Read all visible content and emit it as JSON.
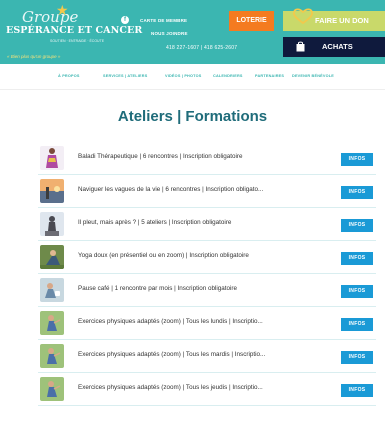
{
  "header": {
    "logo": {
      "script": "Groupe",
      "main": "ESPÉRANCE ET CANCER",
      "sub": "SOUTIEN · ENTRAIDE · ÉCOUTE",
      "tagline": "« Bien plus qu'un groupe »"
    },
    "links": {
      "carte": "CARTE DE MEMBRE",
      "joindre": "NOUS JOINDRE"
    },
    "phones": "418 227-1607 | 418 625-2607",
    "buttons": {
      "loterie": "LOTERIE",
      "don": "FAIRE UN DON",
      "achats": "ACHATS"
    }
  },
  "nav": {
    "items": [
      "À PROPOS",
      "SERVICES | ATELIERS",
      "VIDÉOS | PHOTOS",
      "CALENDRIERS",
      "PARTENAIRES",
      "DEVENIR BÉNÉVOLE"
    ]
  },
  "main": {
    "title": "Ateliers | Formations",
    "infos_label": "INFOS",
    "items": [
      {
        "label": "Baladi Thérapeutique | 6 rencontres | Inscription obligatoire",
        "thumb": "dancer"
      },
      {
        "label": "Naviguer les vagues de la vie | 6 rencontres | Inscription obligato...",
        "thumb": "seascape"
      },
      {
        "label": "Il pleut, mais après ? | 5 ateliers | Inscription obligatoire",
        "thumb": "statue"
      },
      {
        "label": "Yoga doux (en présentiel ou en zoom) | Inscription obligatoire",
        "thumb": "yoga"
      },
      {
        "label": "Pause café | 1 rencontre par mois | Inscription obligatoire",
        "thumb": "cafe"
      },
      {
        "label": "Exercices physiques adaptés (zoom) | Tous les lundis | Inscriptio...",
        "thumb": "exercise"
      },
      {
        "label": "Exercices physiques adaptés (zoom) | Tous les mardis | Inscriptio...",
        "thumb": "exercise"
      },
      {
        "label": "Exercices physiques adaptés (zoom) | Tous les jeudis | Inscriptio...",
        "thumb": "exercise"
      }
    ]
  },
  "colors": {
    "header_bg": "#3bb6b1",
    "loterie": "#f47b20",
    "don": "#c9d96a",
    "achats": "#0f1a3d",
    "title": "#1f6c7a",
    "infos": "#1a9ad6"
  }
}
